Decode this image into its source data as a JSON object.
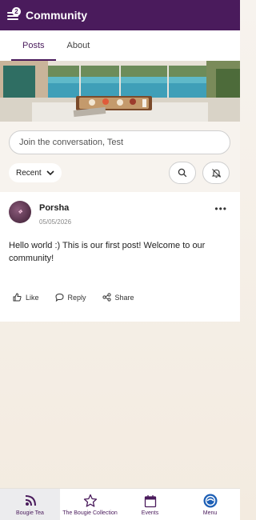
{
  "header": {
    "title": "Community",
    "notification_count": "2",
    "color": "#4a1b5c"
  },
  "tabs": [
    {
      "label": "Posts",
      "active": true
    },
    {
      "label": "About",
      "active": false
    }
  ],
  "compose": {
    "placeholder": "Join the conversation, Test"
  },
  "filters": {
    "sort_label": "Recent",
    "search_icon": "search-icon",
    "mute_icon": "bell-off-icon"
  },
  "post": {
    "author": "Porsha",
    "date": "05/05/2026",
    "body": "Hello world :) This is our first post! Welcome to our community!",
    "actions": {
      "like": "Like",
      "reply": "Reply",
      "share": "Share"
    }
  },
  "bottom_nav": [
    {
      "label": "Bougie Tea",
      "icon": "podcast-icon",
      "active": true
    },
    {
      "label": "The Bougie Collection",
      "icon": "star-icon",
      "active": false
    },
    {
      "label": "Events",
      "icon": "calendar-icon",
      "active": false
    },
    {
      "label": "Menu",
      "icon": "logo-icon",
      "active": false
    }
  ]
}
